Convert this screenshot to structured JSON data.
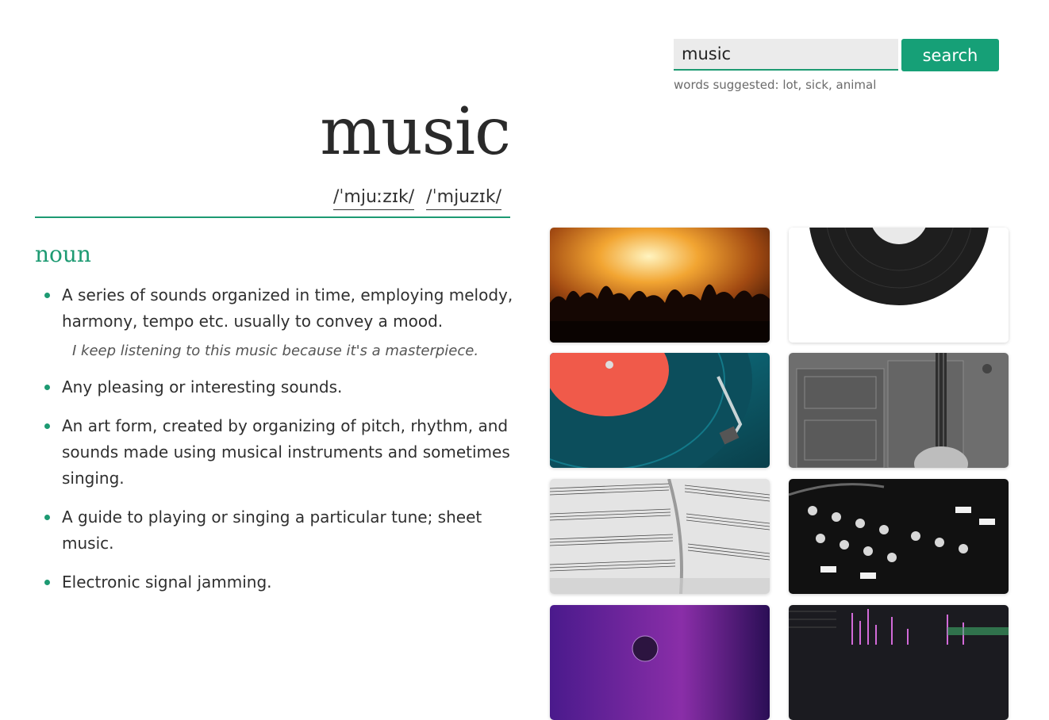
{
  "search": {
    "value": "music",
    "button_label": "search",
    "suggested_prefix": "words suggested: ",
    "suggested_words": "lot, sick, animal"
  },
  "entry": {
    "word": "music",
    "pronunciations": [
      "/ˈmjuːzɪk/",
      "/ˈmjuzɪk/"
    ],
    "part_of_speech": "noun",
    "definitions": [
      {
        "text": "A series of sounds organized in time, employing melody, harmony, tempo etc. usually to convey a mood.",
        "example": "I keep listening to this music because it's a masterpiece."
      },
      {
        "text": "Any pleasing or interesting sounds."
      },
      {
        "text": "An art form, created by organizing of pitch, rhythm, and sounds made using musical instruments and sometimes singing."
      },
      {
        "text": "A guide to playing or singing a particular tune; sheet music."
      },
      {
        "text": "Electronic signal jamming."
      }
    ]
  },
  "images": [
    {
      "name": "concert-crowd-image"
    },
    {
      "name": "vinyl-record-image"
    },
    {
      "name": "turntable-image"
    },
    {
      "name": "guitar-door-image"
    },
    {
      "name": "sheet-music-image"
    },
    {
      "name": "mixing-console-image"
    },
    {
      "name": "stage-microphone-image"
    },
    {
      "name": "audio-editor-image"
    }
  ],
  "colors": {
    "accent": "#1d9a72",
    "button": "#16a077",
    "input_bg": "#ebebeb"
  }
}
